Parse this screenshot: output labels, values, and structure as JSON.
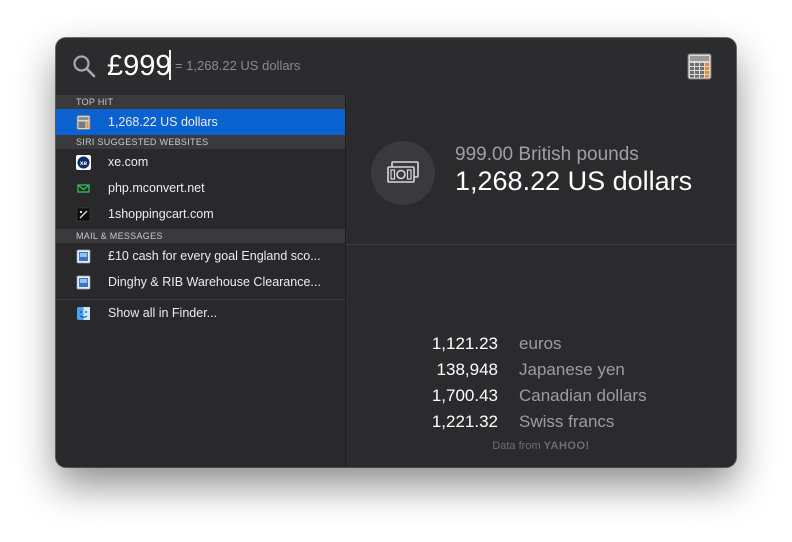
{
  "search": {
    "query": "£999",
    "inline_result": "= 1,268.22 US dollars"
  },
  "sections": {
    "top_hit": {
      "header": "TOP HIT",
      "items": [
        {
          "label": "1,268.22 US dollars",
          "icon": "calculator-icon",
          "selected": true
        }
      ]
    },
    "siri": {
      "header": "SIRI SUGGESTED WEBSITES",
      "items": [
        {
          "label": "xe.com",
          "icon": "xe-favicon-icon"
        },
        {
          "label": "php.mconvert.net",
          "icon": "mconvert-favicon-icon"
        },
        {
          "label": "1shoppingcart.com",
          "icon": "shoppingcart-favicon-icon"
        }
      ]
    },
    "mail": {
      "header": "MAIL & MESSAGES",
      "items": [
        {
          "label": "£10 cash for every goal England sco...",
          "icon": "mail-icon"
        },
        {
          "label": "Dinghy & RIB Warehouse Clearance...",
          "icon": "mail-icon"
        }
      ]
    },
    "finder": {
      "items": [
        {
          "label": "Show all in Finder...",
          "icon": "finder-icon"
        }
      ]
    }
  },
  "preview": {
    "from": "999.00 British pounds",
    "to": "1,268.22 US dollars",
    "conversions": [
      {
        "amount": "1,121.23",
        "currency": "euros"
      },
      {
        "amount": "138,948",
        "currency": "Japanese yen"
      },
      {
        "amount": "1,700.43",
        "currency": "Canadian dollars"
      },
      {
        "amount": "1,221.32",
        "currency": "Swiss francs"
      }
    ],
    "footer_prefix": "Data from",
    "footer_brand": "YAHOO!"
  },
  "colors": {
    "selection": "#0a62d0",
    "background": "#2b2b2d"
  }
}
